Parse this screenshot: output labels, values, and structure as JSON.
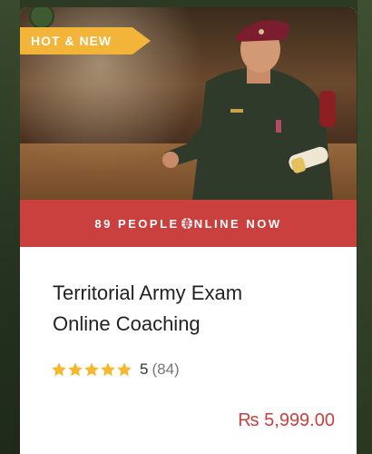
{
  "badge": {
    "label": "HOT & NEW"
  },
  "online": {
    "prefix": "89 PEOPLE ",
    "suffix": "NLINE NOW"
  },
  "course": {
    "title_line1": "Territorial Army Exam",
    "title_line2": "Online Coaching"
  },
  "rating": {
    "value": "5",
    "count": "(84)",
    "stars": 5
  },
  "price": {
    "text": "₨ 5,999.00"
  },
  "colors": {
    "accent": "#c9403f",
    "badge": "#f2b53a",
    "star": "#f5b82e"
  }
}
